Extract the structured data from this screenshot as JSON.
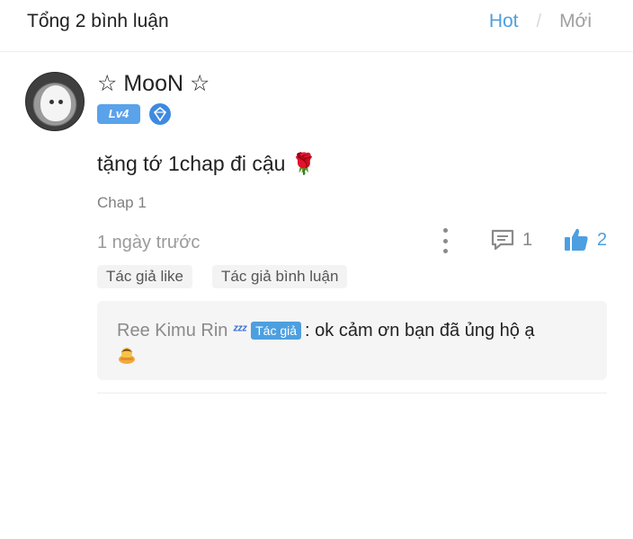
{
  "header": {
    "title": "Tổng 2 bình luận",
    "sort_hot": "Hot",
    "sort_separator": "/",
    "sort_new": "Mới",
    "accent_color": "#4d9fe0"
  },
  "comment": {
    "username": "☆ MooN ☆",
    "level_badge": "Lv4",
    "text": "tặng tớ 1chap đi cậu 🌹",
    "chapter": "Chap 1",
    "time": "1 ngày trước",
    "reply_count": "1",
    "like_count": "2",
    "tags": [
      "Tác giả like",
      "Tác giả bình luận"
    ],
    "icons": {
      "avatar": "cat-avatar",
      "badge": "diamond-badge-icon",
      "more": "more-vertical-icon",
      "reply": "comment-icon",
      "like": "thumbs-up-icon"
    }
  },
  "reply": {
    "author": "Ree Kimu Rin",
    "zzz": "ᶻᶻᶻ",
    "author_badge": "Tác giả",
    "text": ": ok cảm ơn bạn đã ủng hộ ạ",
    "emoji_icon": "bowing-person-icon"
  }
}
